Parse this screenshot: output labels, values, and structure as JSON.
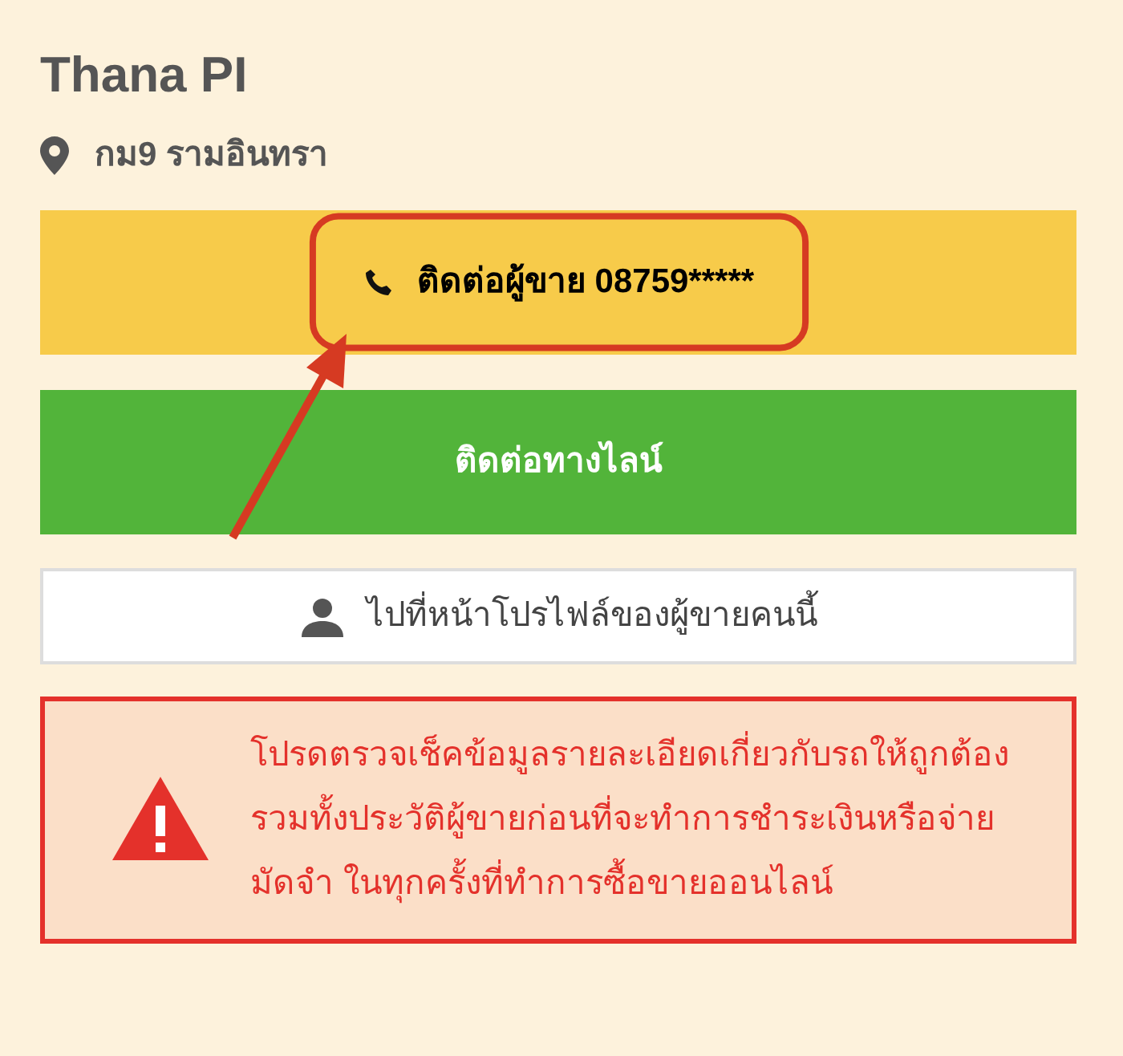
{
  "seller": {
    "name": "Thana PI",
    "location": "กม9 รามอินทรา"
  },
  "buttons": [
    {
      "kind": "phone",
      "label": "ติดต่อผู้ขาย 08759*****",
      "highlighted": true
    },
    {
      "kind": "line",
      "label": "ติดต่อทางไลน์",
      "highlighted": false
    },
    {
      "kind": "profile",
      "label": "ไปที่หน้าโปรไฟล์ของผู้ขายคนนี้",
      "highlighted": false
    }
  ],
  "warning": {
    "text": "โปรดตรวจเช็คข้อมูลรายละเอียดเกี่ยวกับรถให้ถูกต้องรวมทั้งประวัติผู้ขายก่อนที่จะทำการชำระเงินหรือจ่ายมัดจำ ในทุกครั้งที่ทำการซื้อขายออนไลน์"
  }
}
